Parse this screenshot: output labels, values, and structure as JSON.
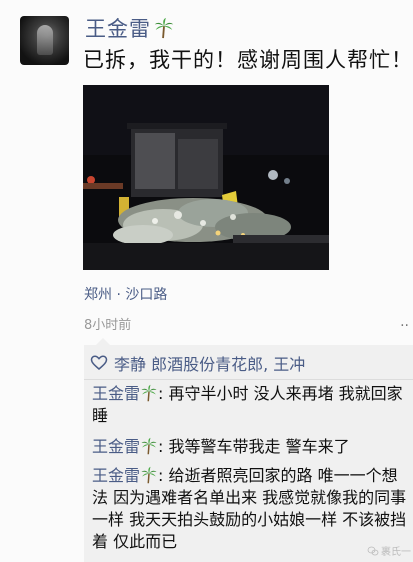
{
  "post": {
    "author": "王金雷",
    "text": "已拆，我干的！感谢周围人帮忙！",
    "location": "郑州 · 沙口路",
    "time": "8小时前"
  },
  "likes": {
    "names": "李静  郎酒股份青花郎, 王冲"
  },
  "comments": [
    {
      "author": "王金雷",
      "text": "再守半小时 没人来再堵 我就回家睡"
    },
    {
      "author": "王金雷",
      "text": "我等警车带我走  警车来了"
    },
    {
      "author": "王金雷",
      "text": "给逝者照亮回家的路 唯一一个想法 因为遇难者名单出来 我感觉就像我的同事一样 我天天拍头鼓励的小姑娘一样 不该被挡着 仅此而已"
    }
  ],
  "watermark": "裹氏一"
}
